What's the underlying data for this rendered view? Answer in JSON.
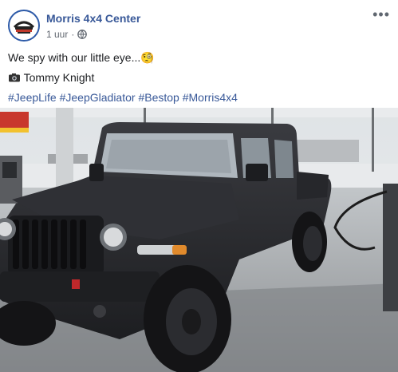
{
  "post": {
    "page_name": "Morris 4x4 Center",
    "timestamp": "1 uur",
    "separator": "·",
    "privacy_icon": "globe-icon",
    "more_icon": "more-options-icon",
    "caption_text": "We spy with our little eye...",
    "caption_emoji": "🧐",
    "credit_icon": "camera-icon",
    "credit_text": "Tommy Knight",
    "hashtags": [
      "#JeepLife",
      "#JeepGladiator",
      "#Bestop",
      "#Morris4x4"
    ],
    "avatar_logo": "Morris 4x4 Center logo",
    "photo_subject": "jeep-gladiator-photo"
  },
  "colors": {
    "link": "#385898",
    "text": "#1c1e21",
    "meta": "#616770",
    "truck": "#2a2b2f"
  }
}
